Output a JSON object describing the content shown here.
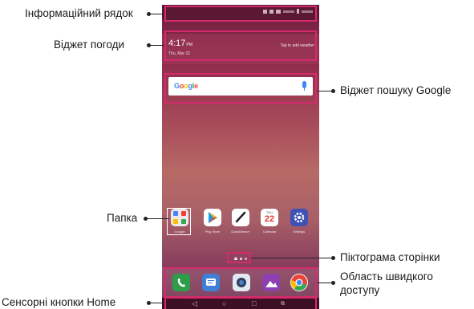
{
  "labels": {
    "status_bar": "Інформаційний рядок",
    "weather_widget": "Віджет погоди",
    "google_search_widget": "Віджет пошуку Google",
    "folder": "Папка",
    "page_icon": "Піктограма сторінки",
    "quick_access_line1": "Область швидкого",
    "quick_access_line2": "доступу",
    "home_touch_buttons": "Сенсорні кнопки Home"
  },
  "screen": {
    "weather_time": "4:17",
    "weather_time_suffix": "PM",
    "weather_date": "Thu, Mar 22",
    "weather_tap": "Tap to add weather",
    "search_logo": "Google",
    "apps": [
      {
        "name": "Google",
        "label": "Google"
      },
      {
        "name": "Play Store",
        "label": "Play Store"
      },
      {
        "name": "QuickMemo+",
        "label": "QuickMemo+"
      },
      {
        "name": "Calendar",
        "label": "Calendar",
        "day_of_week": "THU",
        "day": "22"
      },
      {
        "name": "Settings",
        "label": "Settings"
      }
    ],
    "dock": [
      "Phone",
      "Messaging",
      "Camera",
      "Gallery",
      "Chrome"
    ]
  },
  "colors": {
    "highlight": "#d62a6e",
    "wallpaper_top": "#6e1f3f",
    "wallpaper_mid": "#b76a66"
  }
}
